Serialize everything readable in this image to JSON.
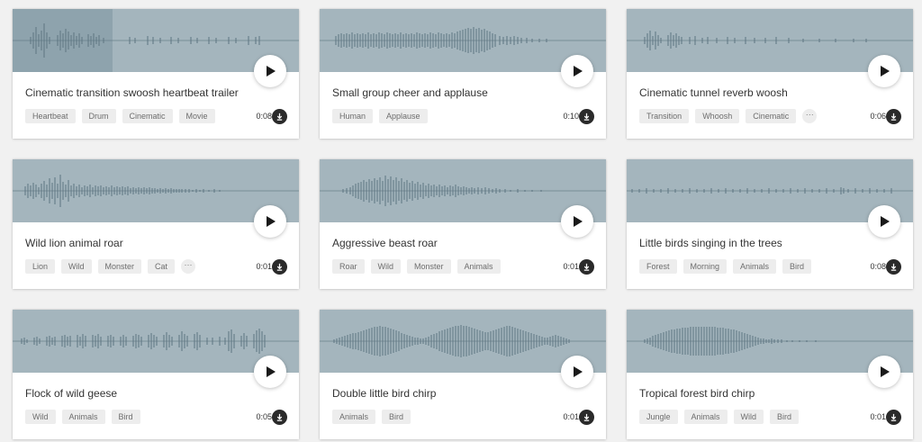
{
  "colors": {
    "page_background": "#f1f1f1",
    "waveform_background": "#a4b5bd",
    "waveform_bars": "#5d7581",
    "played_overlay": "#8ea3ad",
    "tag_background": "#ededed",
    "download_button": "#2a2a2a"
  },
  "icons": {
    "play": "play-icon",
    "download": "download-icon",
    "more": "more-icon"
  },
  "cards": [
    {
      "title": "Cinematic transition swoosh heartbeat trailer",
      "tags": [
        "Heartbeat",
        "Drum",
        "Cinematic",
        "Movie"
      ],
      "has_more": false,
      "duration": "0:08",
      "played_fraction": 0.35
    },
    {
      "title": "Small group cheer and applause",
      "tags": [
        "Human",
        "Applause"
      ],
      "has_more": false,
      "duration": "0:10",
      "played_fraction": 0
    },
    {
      "title": "Cinematic tunnel reverb woosh",
      "tags": [
        "Transition",
        "Whoosh",
        "Cinematic"
      ],
      "has_more": true,
      "duration": "0:06",
      "played_fraction": 0
    },
    {
      "title": "Wild lion animal roar",
      "tags": [
        "Lion",
        "Wild",
        "Monster",
        "Cat"
      ],
      "has_more": true,
      "duration": "0:01",
      "played_fraction": 0
    },
    {
      "title": "Aggressive beast roar",
      "tags": [
        "Roar",
        "Wild",
        "Monster",
        "Animals"
      ],
      "has_more": false,
      "duration": "0:01",
      "played_fraction": 0
    },
    {
      "title": "Little birds singing in the trees",
      "tags": [
        "Forest",
        "Morning",
        "Animals",
        "Bird"
      ],
      "has_more": false,
      "duration": "0:08",
      "played_fraction": 0
    },
    {
      "title": "Flock of wild geese",
      "tags": [
        "Wild",
        "Animals",
        "Bird"
      ],
      "has_more": false,
      "duration": "0:05",
      "played_fraction": 0
    },
    {
      "title": "Double little bird chirp",
      "tags": [
        "Animals",
        "Bird"
      ],
      "has_more": false,
      "duration": "0:01",
      "played_fraction": 0
    },
    {
      "title": "Tropical forest bird chirp",
      "tags": [
        "Jungle",
        "Animals",
        "Wild",
        "Bird"
      ],
      "has_more": false,
      "duration": "0:01",
      "played_fraction": 0
    }
  ]
}
